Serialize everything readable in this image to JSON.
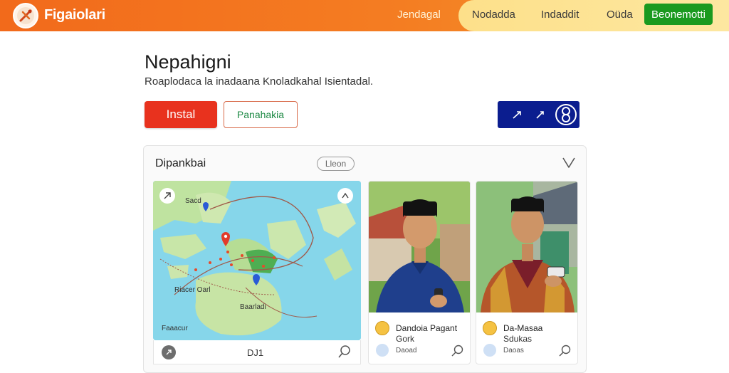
{
  "header": {
    "brand": "Figaiolari",
    "nav": [
      "Jendagal",
      "Nodadda",
      "Indaddit",
      "Oüda"
    ],
    "cta": "Beonemotti"
  },
  "hero": {
    "title": "Nepahigni",
    "subtitle": "Roaplodaca la inadaana Knoladkahal Isientadal.",
    "install_label": "Instal",
    "secondary_label": "Panahakia"
  },
  "card": {
    "title": "Dipankbai",
    "badge": "Lleon",
    "map": {
      "labels": [
        "Sacd",
        "Riacer Oarl",
        "Baarladi",
        "Faaacur"
      ],
      "footer_label": "DJ1"
    },
    "people": [
      {
        "name": "Dandoia Pagant",
        "role": "Gork",
        "meta": "Daoad"
      },
      {
        "name": "Da-Masaa",
        "role": "Sdukas",
        "meta": "Daoas"
      }
    ]
  },
  "colors": {
    "accent_orange": "#f26a1b",
    "install_red": "#e8321e",
    "cta_green": "#1a9a1f",
    "blue_button": "#0b1d8f"
  }
}
